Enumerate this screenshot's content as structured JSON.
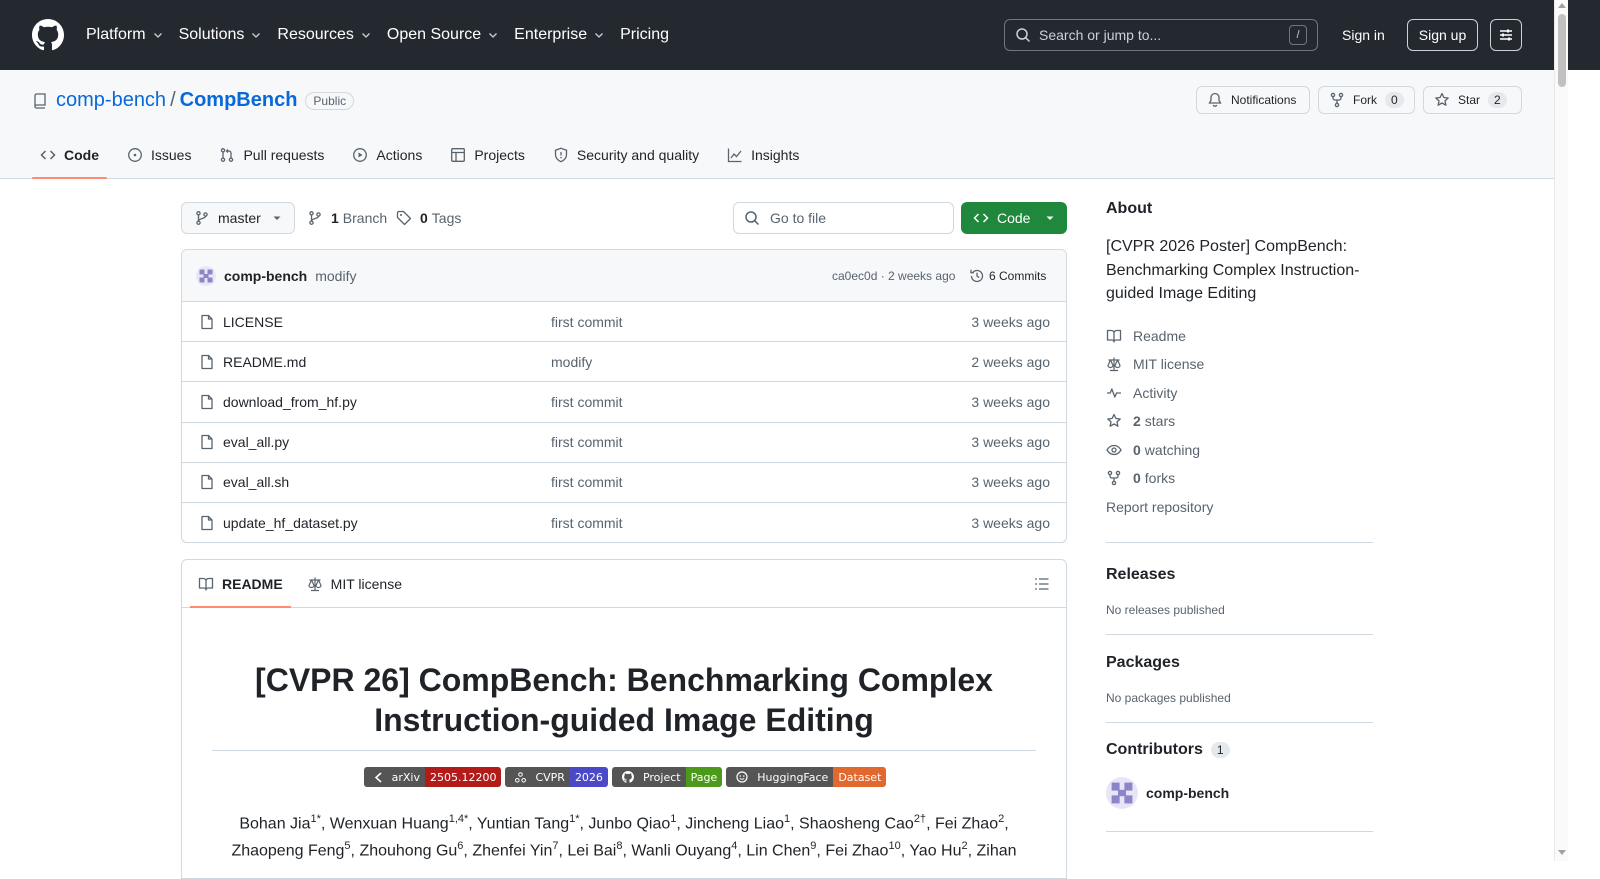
{
  "header": {
    "nav": [
      {
        "label": "Platform",
        "has_menu": true
      },
      {
        "label": "Solutions",
        "has_menu": true
      },
      {
        "label": "Resources",
        "has_menu": true
      },
      {
        "label": "Open Source",
        "has_menu": true
      },
      {
        "label": "Enterprise",
        "has_menu": true
      },
      {
        "label": "Pricing",
        "has_menu": false
      }
    ],
    "search_placeholder": "Search or jump to...",
    "search_shortcut": "/",
    "signin": "Sign in",
    "signup": "Sign up"
  },
  "repo": {
    "owner": "comp-bench",
    "separator": "/",
    "name": "CompBench",
    "visibility": "Public",
    "notifications": "Notifications",
    "fork_label": "Fork",
    "fork_count": "0",
    "star_label": "Star",
    "star_count": "2",
    "tabs": [
      {
        "label": "Code",
        "icon": "code-icon",
        "selected": true
      },
      {
        "label": "Issues",
        "icon": "issue-icon",
        "selected": false
      },
      {
        "label": "Pull requests",
        "icon": "pull-request-icon",
        "selected": false
      },
      {
        "label": "Actions",
        "icon": "play-icon",
        "selected": false
      },
      {
        "label": "Projects",
        "icon": "table-icon",
        "selected": false
      },
      {
        "label": "Security and quality",
        "icon": "shield-icon",
        "selected": false
      },
      {
        "label": "Insights",
        "icon": "graph-icon",
        "selected": false
      }
    ]
  },
  "toolbar": {
    "branch": "master",
    "branch_count": "1",
    "branch_label": "Branch",
    "tag_count": "0",
    "tag_label": "Tags",
    "goto_file": "Go to file",
    "code_button": "Code"
  },
  "latest_commit": {
    "author": "comp-bench",
    "message": "modify",
    "hash_time": "ca0ec0d · 2 weeks ago",
    "commits": "6 Commits"
  },
  "files": [
    {
      "name": "LICENSE",
      "message": "first commit",
      "date": "3 weeks ago"
    },
    {
      "name": "README.md",
      "message": "modify",
      "date": "2 weeks ago"
    },
    {
      "name": "download_from_hf.py",
      "message": "first commit",
      "date": "3 weeks ago"
    },
    {
      "name": "eval_all.py",
      "message": "first commit",
      "date": "3 weeks ago"
    },
    {
      "name": "eval_all.sh",
      "message": "first commit",
      "date": "3 weeks ago"
    },
    {
      "name": "update_hf_dataset.py",
      "message": "first commit",
      "date": "3 weeks ago"
    }
  ],
  "readme": {
    "tab_readme": "README",
    "tab_license": "MIT license",
    "title": "[CVPR 26] CompBench: Benchmarking Complex Instruction-guided Image Editing",
    "badges": [
      {
        "left": "arXiv",
        "right": "2505.12200",
        "color": "#b31b1b",
        "icon": "arxiv-icon"
      },
      {
        "left": "CVPR",
        "right": "2026",
        "color": "#4b49c8",
        "icon": "cvpr-icon"
      },
      {
        "left": "Project",
        "right": "Page",
        "color": "#4c9a1a",
        "icon": "github-icon"
      },
      {
        "left": "HuggingFace",
        "right": "Dataset",
        "color": "#e1682e",
        "icon": "huggingface-icon"
      }
    ],
    "authors": [
      {
        "name": "Bohan Jia",
        "sup": "1*"
      },
      {
        "name": "Wenxuan Huang",
        "sup": "1,4*"
      },
      {
        "name": "Yuntian Tang",
        "sup": "1*"
      },
      {
        "name": "Junbo Qiao",
        "sup": "1"
      },
      {
        "name": "Jincheng Liao",
        "sup": "1"
      },
      {
        "name": "Shaosheng Cao",
        "sup": "2†"
      },
      {
        "name": "Fei Zhao",
        "sup": "2"
      },
      {
        "name": "Zhaopeng Feng",
        "sup": "5"
      },
      {
        "name": "Zhouhong Gu",
        "sup": "6"
      },
      {
        "name": "Zhenfei Yin",
        "sup": "7"
      },
      {
        "name": "Lei Bai",
        "sup": "8"
      },
      {
        "name": "Wanli Ouyang",
        "sup": "4"
      },
      {
        "name": "Lin Chen",
        "sup": "9"
      },
      {
        "name": "Fei Zhao",
        "sup": "10"
      },
      {
        "name": "Yao Hu",
        "sup": "2"
      },
      {
        "name": "Zihan",
        "sup": ""
      }
    ]
  },
  "sidebar": {
    "about_title": "About",
    "description": "[CVPR 2026 Poster] CompBench: Benchmarking Complex Instruction-guided Image Editing",
    "links": [
      {
        "icon": "book-icon",
        "count": "",
        "label": "Readme"
      },
      {
        "icon": "law-icon",
        "count": "",
        "label": "MIT license"
      },
      {
        "icon": "pulse-icon",
        "count": "",
        "label": "Activity"
      },
      {
        "icon": "star-icon",
        "count": "2",
        "label": "stars"
      },
      {
        "icon": "eye-icon",
        "count": "0",
        "label": "watching"
      },
      {
        "icon": "fork-icon",
        "count": "0",
        "label": "forks"
      }
    ],
    "report": "Report repository",
    "releases_title": "Releases",
    "releases_text": "No releases published",
    "packages_title": "Packages",
    "packages_text": "No packages published",
    "contributors_title": "Contributors",
    "contributors_count": "1",
    "contributor_name": "comp-bench"
  }
}
